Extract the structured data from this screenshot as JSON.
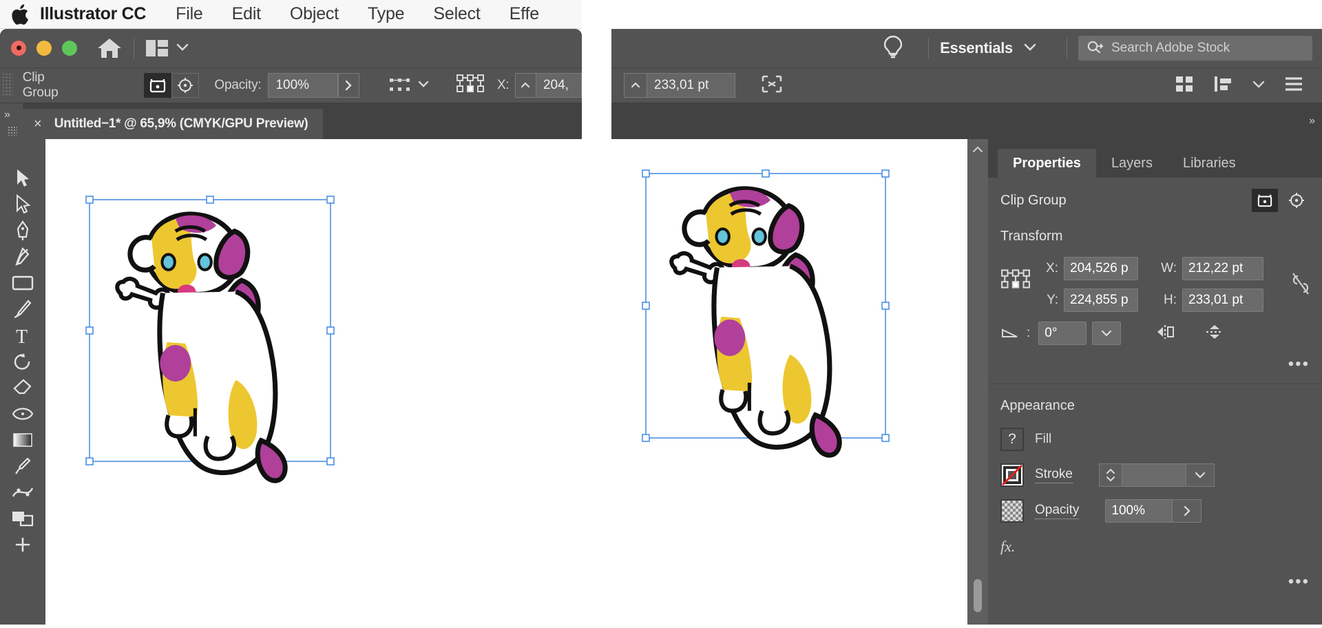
{
  "menubar": {
    "apple_icon": "apple-logo-icon",
    "app_name": "Illustrator CC",
    "items": [
      "File",
      "Edit",
      "Object",
      "Type",
      "Select",
      "Effe"
    ]
  },
  "app_window": {
    "traffic_lights": [
      "close",
      "minimize",
      "zoom"
    ],
    "home_icon": "home-icon",
    "arrange_documents_icon": "arrange-documents-icon",
    "arrange_chevron": "chevron-down-icon"
  },
  "control_bar": {
    "selection_label": "Clip Group",
    "isolate_icon": "isolate-selected-object-icon",
    "target_icon": "target-indicator-icon",
    "opacity_label": "Opacity:",
    "opacity_value": "100%",
    "opacity_arrow": "chevron-right-icon",
    "align_icon": "align-options-icon",
    "align_chevron": "chevron-down-icon",
    "transform_ref_icon": "reference-point-grid-icon",
    "x_label": "X:",
    "x_value": "204,",
    "x_stepper_icon": "stepper-up-icon"
  },
  "right_control_bar": {
    "h_stepper_icon": "stepper-up-icon",
    "h_value": "233,01 pt",
    "shape_icon": "shape-builder-icon",
    "grid_view_icon": "grid-view-icon",
    "distribute_icon": "distribute-spacing-icon",
    "distribute_chevron": "chevron-down-icon",
    "list_view_icon": "list-view-icon"
  },
  "document_tab": {
    "close_icon": "close-tab-icon",
    "title": "Untitled−1* @ 65,9% (CMYK/GPU Preview)"
  },
  "toolbar": {
    "panel_chevron": "chevron-double-right-icon",
    "tools": [
      {
        "name": "selection-tool",
        "icon": "cursor-arrow-icon"
      },
      {
        "name": "direct-selection-tool",
        "icon": "white-arrow-icon"
      },
      {
        "name": "pen-tool",
        "icon": "pen-nib-icon"
      },
      {
        "name": "curvature-tool",
        "icon": "curvature-pen-icon"
      },
      {
        "name": "rectangle-tool",
        "icon": "rectangle-icon"
      },
      {
        "name": "paintbrush-tool",
        "icon": "paintbrush-icon"
      },
      {
        "name": "type-tool",
        "icon": "letter-t-icon"
      },
      {
        "name": "rotate-tool",
        "icon": "rotate-arrow-icon"
      },
      {
        "name": "eraser-tool",
        "icon": "eraser-icon"
      },
      {
        "name": "width-tool",
        "icon": "width-shape-icon"
      },
      {
        "name": "gradient-tool",
        "icon": "gradient-square-icon"
      },
      {
        "name": "eyedropper-tool",
        "icon": "eyedropper-icon"
      },
      {
        "name": "puppet-warp-tool",
        "icon": "puppet-warp-icon"
      },
      {
        "name": "artboard-tool",
        "icon": "artboard-icon"
      },
      {
        "name": "hand-tool",
        "icon": "plus-icon"
      }
    ]
  },
  "right_top_bar": {
    "bulb_icon": "lightbulb-icon",
    "workspace": "Essentials",
    "workspace_chevron": "chevron-down-icon",
    "search_icon": "search-adobe-stock-icon",
    "search_placeholder": "Search Adobe Stock"
  },
  "panel": {
    "tabs": [
      {
        "label": "Properties",
        "selected": true
      },
      {
        "label": "Layers",
        "selected": false
      },
      {
        "label": "Libraries",
        "selected": false
      }
    ],
    "collapse_icon": "chevron-double-right-icon",
    "object_name": "Clip Group",
    "isolate_icon": "isolate-selected-object-icon",
    "target_icon": "target-indicator-icon",
    "transform": {
      "title": "Transform",
      "reference_point_icon": "reference-point-grid-icon",
      "x_label": "X:",
      "x_value": "204,526 p",
      "y_label": "Y:",
      "y_value": "224,855 p",
      "w_label": "W:",
      "w_value": "212,22 pt",
      "h_label": "H:",
      "h_value": "233,01 pt",
      "link_icon": "unlink-broken-chain-icon",
      "angle_icon": "angle-rotate-icon",
      "angle_label": ":",
      "angle_value": "0°",
      "angle_chevron": "chevron-down-icon",
      "flip_horizontal_icon": "flip-horizontal-icon",
      "flip_vertical_icon": "flip-vertical-icon",
      "more_options_icon": "more-options-ellipsis-icon"
    },
    "appearance": {
      "title": "Appearance",
      "fill_label": "Fill",
      "fill_swatch_icon": "question-mark-mixed-fill-icon",
      "stroke_label": "Stroke",
      "stroke_swatch_icon": "none-stroke-diagonal-red-icon",
      "stroke_weight_value": "",
      "stroke_stepper_icon": "stepper-updown-icon",
      "stroke_chevron": "chevron-down-icon",
      "opacity_label": "Opacity",
      "opacity_swatch_icon": "transparency-checkerboard-icon",
      "opacity_value": "100%",
      "opacity_arrow": "chevron-right-icon",
      "fx_label": "fx.",
      "more_options_icon": "more-options-ellipsis-icon"
    }
  },
  "artwork": {
    "description": "cartoon-dog-illustration",
    "colors": {
      "yellow": "#edc72f",
      "magenta": "#b0409a",
      "pink": "#d63a7f",
      "outline": "#000000",
      "eye_blue": "#63c4dc",
      "selection_blue": "#4a90e2"
    }
  }
}
